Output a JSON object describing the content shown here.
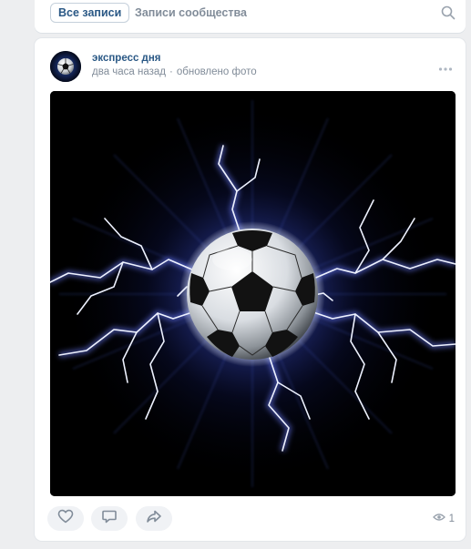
{
  "filter_bar": {
    "tab_all_label": "Все записи",
    "tab_community_label": "Записи сообщества",
    "search_icon": "search-icon"
  },
  "post": {
    "author": "экспресс дня",
    "time": "два часа назад",
    "separator": "·",
    "action_text": "обновлено фото",
    "more_icon": "more-horizontal-icon",
    "image_subject": "soccer ball with lightning",
    "actions": {
      "like_icon": "heart-icon",
      "comment_icon": "comment-icon",
      "share_icon": "share-icon"
    },
    "views": {
      "icon": "eye-icon",
      "count": "1"
    }
  },
  "colors": {
    "link": "#2a5885",
    "secondary": "#818c99",
    "background": "#edeef0",
    "card": "#ffffff",
    "button_bg": "#f0f2f5"
  }
}
